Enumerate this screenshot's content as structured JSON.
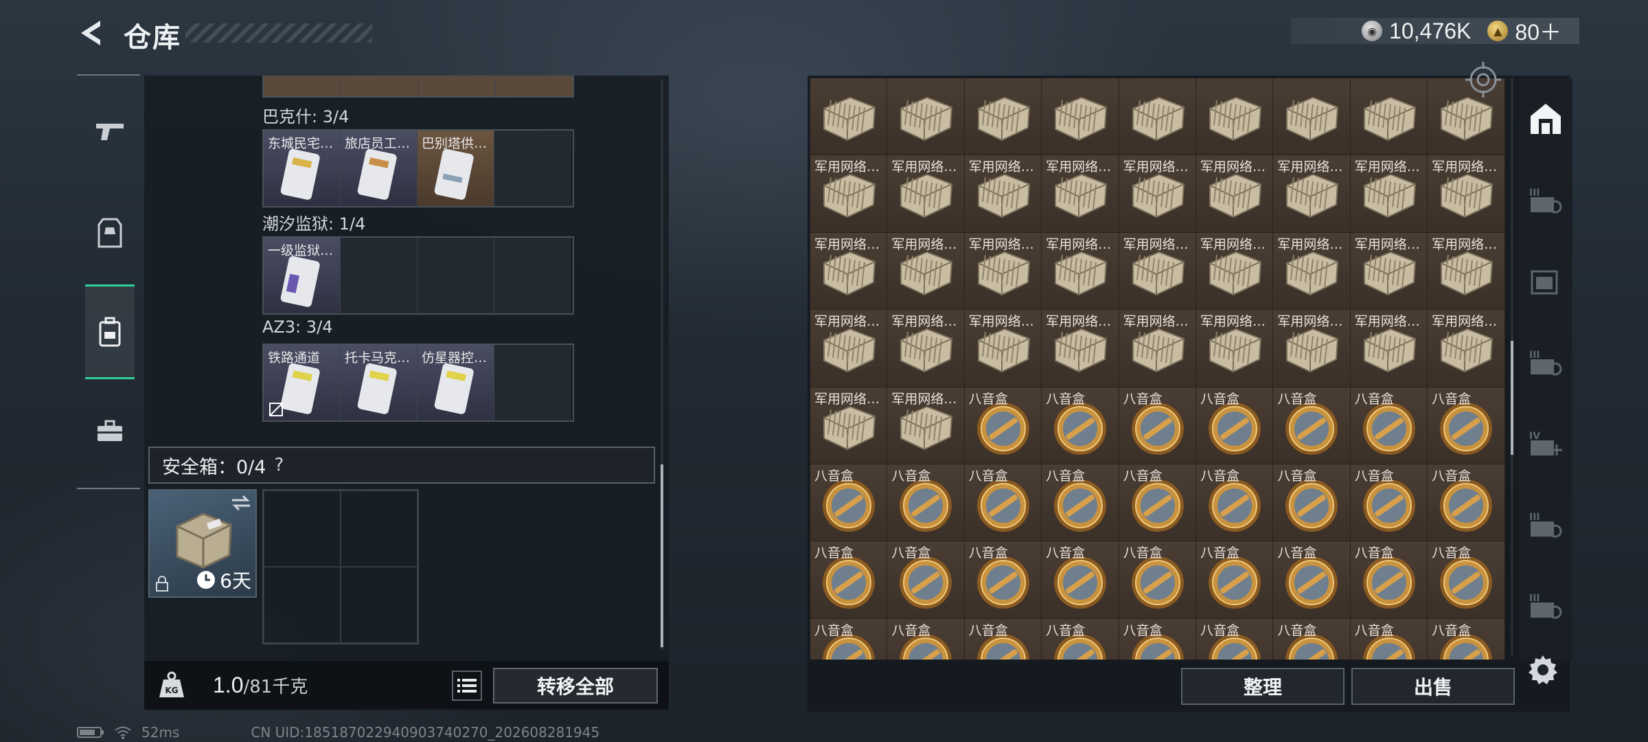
{
  "header": {
    "title": "仓库",
    "currency_silver": "10,476K",
    "currency_gold": "80＋"
  },
  "left_rail": [
    {
      "name": "weapon"
    },
    {
      "name": "gear"
    },
    {
      "name": "backpack",
      "active": true
    },
    {
      "name": "toolbox"
    }
  ],
  "backpack": {
    "sections": [
      {
        "label": "巴克什: 3/4",
        "items": [
          "东城民宅…",
          "旅店员工…",
          "巴别塔供…",
          ""
        ]
      },
      {
        "label": "潮汐监狱: 1/4",
        "items": [
          "一级监狱…",
          "",
          "",
          ""
        ]
      },
      {
        "label": "AZ3: 3/4",
        "items": [
          "铁路通道",
          "托卡马克…",
          "仿星器控…",
          ""
        ]
      }
    ],
    "safe_box_label": "安全箱：0/4",
    "safe_box_help": "?",
    "safe_box_days": "6天",
    "weight_value": "1.0",
    "weight_max": "/81千克",
    "transfer_all": "转移全部"
  },
  "warehouse": {
    "items": [
      "",
      "",
      "",
      "",
      "",
      "",
      "",
      "",
      "",
      "军用网络…",
      "军用网络…",
      "军用网络…",
      "军用网络…",
      "军用网络…",
      "军用网络…",
      "军用网络…",
      "军用网络…",
      "军用网络…",
      "军用网络…",
      "军用网络…",
      "军用网络…",
      "军用网络…",
      "军用网络…",
      "军用网络…",
      "军用网络…",
      "军用网络…",
      "军用网络…",
      "军用网络…",
      "军用网络…",
      "军用网络…",
      "军用网络…",
      "军用网络…",
      "军用网络…",
      "军用网络…",
      "军用网络…",
      "军用网络…",
      "军用网络…",
      "军用网络…",
      "八音盒",
      "八音盒",
      "八音盒",
      "八音盒",
      "八音盒",
      "八音盒",
      "八音盒",
      "八音盒",
      "八音盒",
      "八音盒",
      "八音盒",
      "八音盒",
      "八音盒",
      "八音盒",
      "八音盒",
      "八音盒",
      "八音盒",
      "八音盒",
      "八音盒",
      "八音盒",
      "八音盒",
      "八音盒",
      "八音盒",
      "八音盒",
      "八音盒",
      "八音盒",
      "八音盒",
      "八音盒",
      "八音盒",
      "八音盒",
      "八音盒",
      "八音盒",
      "八音盒",
      "八音盒"
    ],
    "sort_label": "整理",
    "sell_label": "出售"
  },
  "right_rail": [
    "home",
    "III",
    "",
    "III",
    "IV",
    "III",
    "III"
  ],
  "status": {
    "ping": "52ms",
    "uid": "CN UID:1851870229409037402​70_202608281945"
  }
}
